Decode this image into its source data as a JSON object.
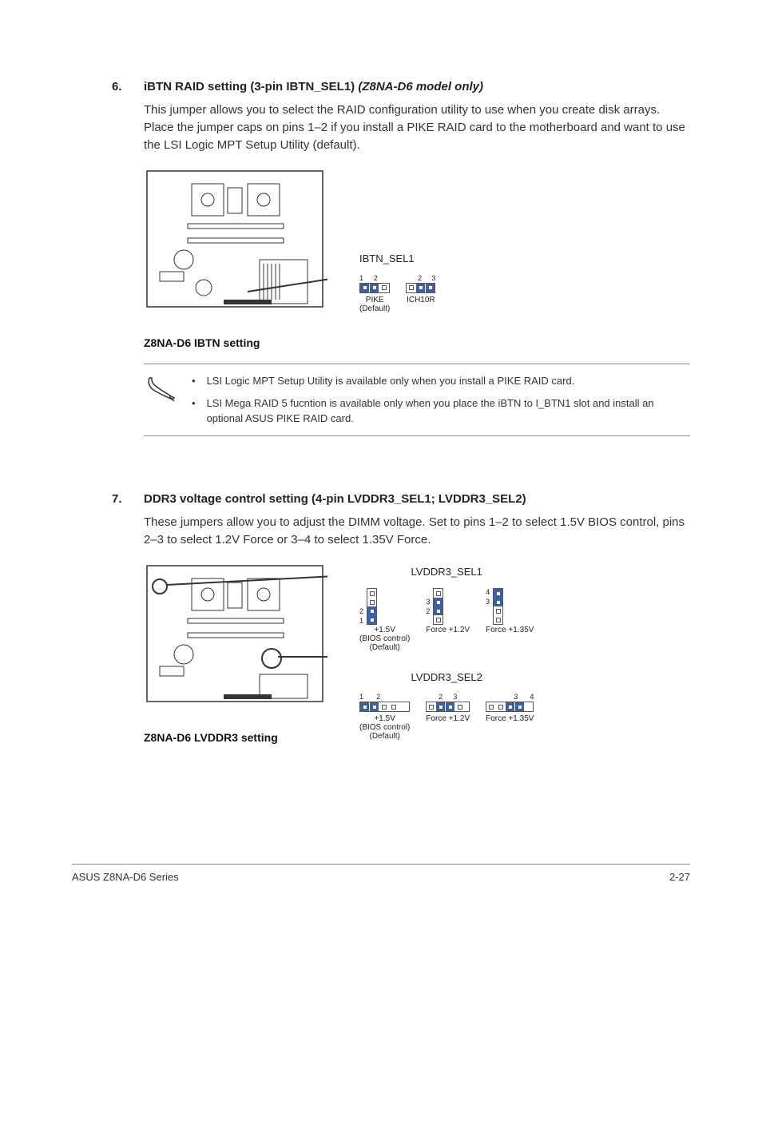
{
  "section6": {
    "num": "6.",
    "title_prefix": "iBTN RAID setting (3-pin IBTN_SEL1) ",
    "title_suffix": "(Z8NA-D6 model only)",
    "body": "This jumper allows you to select the RAID configuration utility to use when you create disk arrays. Place the jumper caps on pins 1–2 if you install a PIKE RAID card to the motherboard and want to use the LSI Logic MPT Setup Utility (default).",
    "diagram_caption": "Z8NA-D6 IBTN setting",
    "jumper_label": "IBTN_SEL1",
    "opt1": {
      "nums_left": "1",
      "nums_right": "2",
      "label1": "PIKE",
      "label2": "(Default)"
    },
    "opt2": {
      "nums_left": "2",
      "nums_right": "3",
      "label1": "ICH10R"
    }
  },
  "notes": {
    "b1": "LSI Logic MPT Setup Utility is available only when you install a PIKE RAID card.",
    "b2": "LSI Mega RAID 5 fucntion is available only when you place the iBTN to I_BTN1 slot and install an optional ASUS PIKE RAID card."
  },
  "section7": {
    "num": "7.",
    "title": "DDR3 voltage control setting (4-pin LVDDR3_SEL1; LVDDR3_SEL2)",
    "body": "These jumpers allow you to adjust the DIMM voltage. Set to pins 1–2 to select 1.5V BIOS control, pins 2–3 to select 1.2V Force or 3–4 to select 1.35V Force.",
    "diagram_caption": "Z8NA-D6 LVDDR3 setting",
    "sel1": {
      "label": "LVDDR3_SEL1",
      "o1": {
        "n1": "1",
        "n2": "2",
        "l1": "+1.5V",
        "l2": "(BIOS control)",
        "l3": "(Default)"
      },
      "o2": {
        "n1": "2",
        "n2": "3",
        "l1": "Force +1.2V"
      },
      "o3": {
        "n1": "3",
        "n2": "4",
        "l1": "Force +1.35V"
      }
    },
    "sel2": {
      "label": "LVDDR3_SEL2",
      "o1": {
        "n1": "1",
        "n2": "2",
        "l1": "+1.5V",
        "l2": "(BIOS control)",
        "l3": "(Default)"
      },
      "o2": {
        "n1": "2",
        "n2": "3",
        "l1": "Force +1.2V"
      },
      "o3": {
        "n1": "3",
        "n2": "4",
        "l1": "Force +1.35V"
      }
    }
  },
  "footer": {
    "left": "ASUS Z8NA-D6 Series",
    "right": "2-27"
  }
}
